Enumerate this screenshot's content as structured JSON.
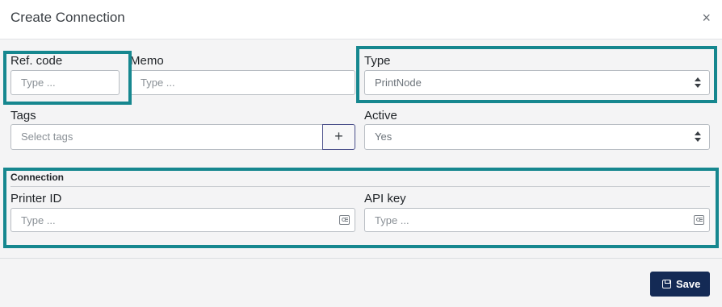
{
  "dialog": {
    "title": "Create Connection",
    "close_glyph": "×"
  },
  "form": {
    "ref_code": {
      "label": "Ref. code",
      "placeholder": "Type ..."
    },
    "memo": {
      "label": "Memo",
      "placeholder": "Type ..."
    },
    "type": {
      "label": "Type",
      "value": "PrintNode"
    },
    "tags": {
      "label": "Tags",
      "placeholder": "Select tags",
      "add_glyph": "+"
    },
    "active": {
      "label": "Active",
      "value": "Yes"
    }
  },
  "connection": {
    "heading": "Connection",
    "printer_id": {
      "label": "Printer ID",
      "placeholder": "Type ..."
    },
    "api_key": {
      "label": "API key",
      "placeholder": "Type ..."
    }
  },
  "footer": {
    "save_label": "Save"
  },
  "icons": {
    "close": "close-icon",
    "select_arrows": "sort-icon",
    "input_addon": "address-card-icon",
    "save": "floppy-disk-icon"
  },
  "colors": {
    "highlight": "#16878f",
    "save_button": "#142a55",
    "background": "#f4f4f5"
  }
}
